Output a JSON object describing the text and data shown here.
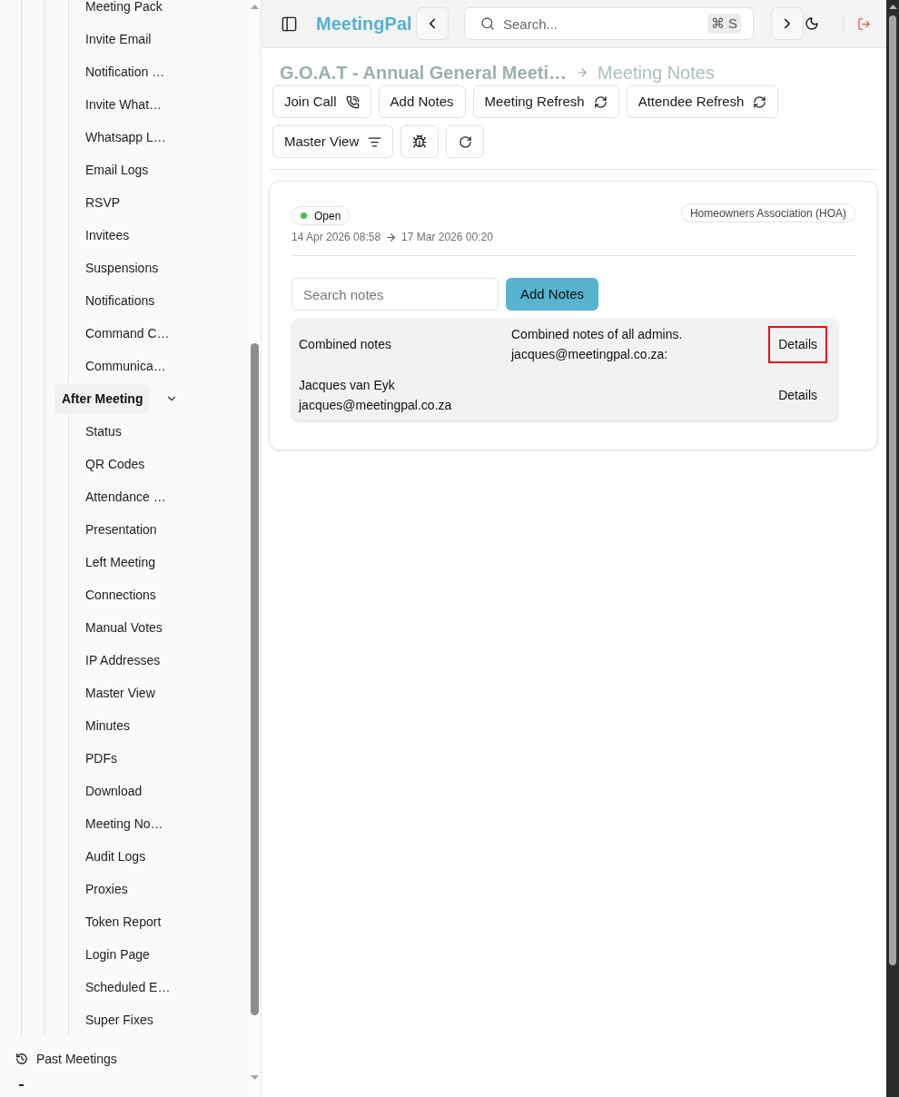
{
  "sidebar": {
    "tree": [
      {
        "kind": "group",
        "children": [
          {
            "kind": "group",
            "children": [
              {
                "kind": "group",
                "children": [
                  {
                    "kind": "item",
                    "label": "Meeting Pack"
                  },
                  {
                    "kind": "item",
                    "label": "Invite Email"
                  },
                  {
                    "kind": "item",
                    "label": "Notification …"
                  },
                  {
                    "kind": "item",
                    "label": "Invite What…"
                  },
                  {
                    "kind": "item",
                    "label": "Whatsapp L…"
                  },
                  {
                    "kind": "item",
                    "label": "Email Logs"
                  },
                  {
                    "kind": "item",
                    "label": "RSVP"
                  },
                  {
                    "kind": "item",
                    "label": "Invitees"
                  },
                  {
                    "kind": "item",
                    "label": "Suspensions"
                  },
                  {
                    "kind": "item",
                    "label": "Notifications"
                  },
                  {
                    "kind": "item",
                    "label": "Command C…"
                  },
                  {
                    "kind": "item",
                    "label": "Communica…"
                  }
                ]
              },
              {
                "kind": "group",
                "label": "After Meeting",
                "expanded": true,
                "children": [
                  {
                    "kind": "item",
                    "label": "Status"
                  },
                  {
                    "kind": "item",
                    "label": "QR Codes"
                  },
                  {
                    "kind": "item",
                    "label": "Attendance …"
                  },
                  {
                    "kind": "item",
                    "label": "Presentation"
                  },
                  {
                    "kind": "item",
                    "label": "Left Meeting"
                  },
                  {
                    "kind": "item",
                    "label": "Connections"
                  },
                  {
                    "kind": "item",
                    "label": "Manual Votes"
                  },
                  {
                    "kind": "item",
                    "label": "IP Addresses"
                  },
                  {
                    "kind": "item",
                    "label": "Master View"
                  },
                  {
                    "kind": "item",
                    "label": "Minutes"
                  },
                  {
                    "kind": "item",
                    "label": "PDFs"
                  },
                  {
                    "kind": "item",
                    "label": "Download"
                  },
                  {
                    "kind": "item",
                    "label": "Meeting No…"
                  },
                  {
                    "kind": "item",
                    "label": "Audit Logs"
                  },
                  {
                    "kind": "item",
                    "label": "Proxies"
                  },
                  {
                    "kind": "item",
                    "label": "Token Report"
                  },
                  {
                    "kind": "item",
                    "label": "Login Page"
                  },
                  {
                    "kind": "item",
                    "label": "Scheduled E…"
                  },
                  {
                    "kind": "item",
                    "label": "Super Fixes"
                  }
                ]
              }
            ]
          }
        ]
      },
      {
        "kind": "section",
        "label": "Past Meetings"
      },
      {
        "kind": "partial"
      }
    ]
  },
  "header": {
    "brand": "MeetingPal",
    "search": {
      "placeholder": "Search...",
      "shortcut": "⌘ S"
    }
  },
  "breadcrumb": [
    "G.O.A.T - Annual General Meeti…",
    "Meeting Notes"
  ],
  "toolbar": [
    "Join Call",
    "Add Notes",
    "Meeting Refresh",
    "Attendee Refresh",
    "Master View"
  ],
  "meeting": {
    "status": "Open",
    "start": "14 Apr 2026 08:58",
    "end": "17 Mar 2026 00:20",
    "category": "Homeowners Association (HOA)"
  },
  "notes": {
    "search": {
      "placeholder": "Search notes"
    },
    "add_button": "Add Notes",
    "rows": [
      {
        "column_1": "Combined notes",
        "column_2": "Combined notes of all admins.\njacques@meetingpal.co.za:",
        "action": "Details",
        "highlighted": true
      },
      {
        "column_1": "Jacques van Eyk\njacques@meetingpal.co.za",
        "action": "Details",
        "highlighted": false
      }
    ]
  }
}
